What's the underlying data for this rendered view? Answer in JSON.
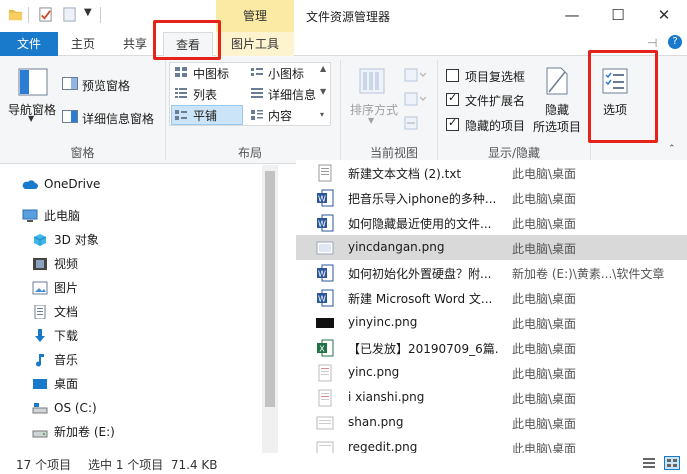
{
  "titlebar": {
    "manage_tab": "管理",
    "title": "文件资源管理器",
    "minimize": "—",
    "maximize": "☐",
    "close": "✕"
  },
  "tabs": {
    "file": "文件",
    "home": "主页",
    "share": "共享",
    "view": "查看",
    "picture_tools": "图片工具"
  },
  "ribbon": {
    "panes": {
      "nav_pane": "导航窗格",
      "preview_pane": "预览窗格",
      "details_pane": "详细信息窗格",
      "group_label": "窗格"
    },
    "layout": {
      "medium_icons": "中图标",
      "small_icons": "小图标",
      "list": "列表",
      "details": "详细信息",
      "tiles": "平铺",
      "content": "内容",
      "group_label": "布局"
    },
    "current_view": {
      "sort_by": "排序方式",
      "group_label": "当前视图"
    },
    "show_hide": {
      "item_checkboxes": "项目复选框",
      "file_extensions": "文件扩展名",
      "hidden_items": "隐藏的项目",
      "hide_selected_line1": "隐藏",
      "hide_selected_line2": "所选项目",
      "group_label": "显示/隐藏",
      "item_checkboxes_checked": false,
      "file_extensions_checked": true,
      "hidden_items_checked": true
    },
    "options": {
      "label": "选项"
    }
  },
  "nav": {
    "items": [
      {
        "label": "OneDrive",
        "icon": "cloud-icon"
      },
      {
        "label": "此电脑",
        "icon": "computer-icon"
      },
      {
        "label": "3D 对象",
        "icon": "cube-icon"
      },
      {
        "label": "视频",
        "icon": "video-icon"
      },
      {
        "label": "图片",
        "icon": "picture-icon"
      },
      {
        "label": "文档",
        "icon": "document-icon"
      },
      {
        "label": "下载",
        "icon": "download-icon"
      },
      {
        "label": "音乐",
        "icon": "music-icon"
      },
      {
        "label": "桌面",
        "icon": "desktop-icon"
      },
      {
        "label": "OS (C:)",
        "icon": "drive-icon"
      },
      {
        "label": "新加卷 (E:)",
        "icon": "drive-icon"
      }
    ]
  },
  "files": [
    {
      "name": "新建文本文档 (2).txt",
      "location": "此电脑\\桌面",
      "icon": "text-file-icon"
    },
    {
      "name": "把音乐导入iphone的多种...",
      "location": "此电脑\\桌面",
      "icon": "word-file-icon"
    },
    {
      "name": "如何隐藏最近使用的文件...",
      "location": "此电脑\\桌面",
      "icon": "word-file-icon"
    },
    {
      "name": "yincdangan.png",
      "location": "此电脑\\桌面",
      "icon": "image-file-icon"
    },
    {
      "name": "如何初始化外置硬盘？附...",
      "location": "新加卷 (E:)\\黄素...\\软件文章",
      "icon": "word-file-icon"
    },
    {
      "name": "新建 Microsoft Word 文...",
      "location": "此电脑\\桌面",
      "icon": "word-file-icon"
    },
    {
      "name": "yinyinc.png",
      "location": "此电脑\\桌面",
      "icon": "image-file-icon"
    },
    {
      "name": "【已发放】20190709_6篇...",
      "location": "此电脑\\桌面",
      "icon": "excel-file-icon"
    },
    {
      "name": "yinc.png",
      "location": "此电脑\\桌面",
      "icon": "image-file-icon"
    },
    {
      "name": "i xianshi.png",
      "location": "此电脑\\桌面",
      "icon": "image-file-icon"
    },
    {
      "name": "shan.png",
      "location": "此电脑\\桌面",
      "icon": "image-file-icon"
    },
    {
      "name": "regedit.png",
      "location": "此电脑\\桌面",
      "icon": "image-file-icon"
    }
  ],
  "status": {
    "count": "17 个项目",
    "selected": "选中 1 个项目  71.4 KB"
  },
  "colors": {
    "accent": "#1979ca",
    "manage_tab": "#fbeaa4",
    "annotation_red": "#e5231a",
    "selected_row": "#d9d9d9"
  }
}
